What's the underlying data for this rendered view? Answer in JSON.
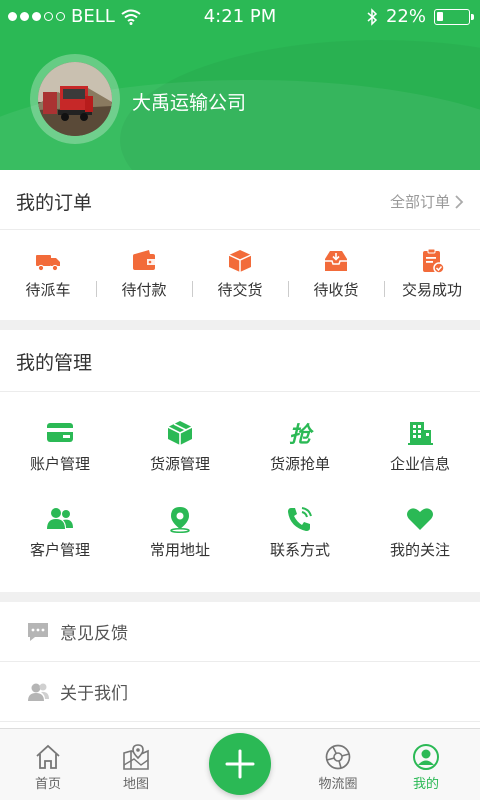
{
  "status_bar": {
    "carrier": "BELL",
    "time": "4:21 PM",
    "battery": "22%",
    "battery_level": 0.22
  },
  "profile": {
    "company_name": "大禹运输公司"
  },
  "orders": {
    "title": "我的订单",
    "all_link": "全部订单",
    "items": [
      {
        "label": "待派车",
        "icon": "truck-icon"
      },
      {
        "label": "待付款",
        "icon": "wallet-icon"
      },
      {
        "label": "待交货",
        "icon": "package-icon"
      },
      {
        "label": "待收货",
        "icon": "inbox-icon"
      },
      {
        "label": "交易成功",
        "icon": "clipboard-check-icon"
      }
    ]
  },
  "management": {
    "title": "我的管理",
    "items": [
      {
        "label": "账户管理",
        "icon": "card-icon"
      },
      {
        "label": "货源管理",
        "icon": "cube-icon"
      },
      {
        "label": "货源抢单",
        "icon": "grab-icon",
        "glyph": "抢"
      },
      {
        "label": "企业信息",
        "icon": "building-icon"
      },
      {
        "label": "客户管理",
        "icon": "users-icon"
      },
      {
        "label": "常用地址",
        "icon": "location-pin-icon"
      },
      {
        "label": "联系方式",
        "icon": "phone-icon"
      },
      {
        "label": "我的关注",
        "icon": "heart-icon"
      }
    ]
  },
  "menu": [
    {
      "label": "意见反馈",
      "icon": "feedback-icon"
    },
    {
      "label": "关于我们",
      "icon": "about-icon"
    }
  ],
  "tabbar": {
    "tabs": [
      {
        "label": "首页",
        "icon": "home-icon"
      },
      {
        "label": "地图",
        "icon": "map-icon"
      },
      {
        "label": "物流圈",
        "icon": "logistics-circle-icon"
      },
      {
        "label": "我的",
        "icon": "profile-icon",
        "active": true
      }
    ]
  },
  "colors": {
    "primary": "#2bb955",
    "order_icon": "#f26b3a",
    "text": "#333333",
    "muted": "#999999"
  }
}
